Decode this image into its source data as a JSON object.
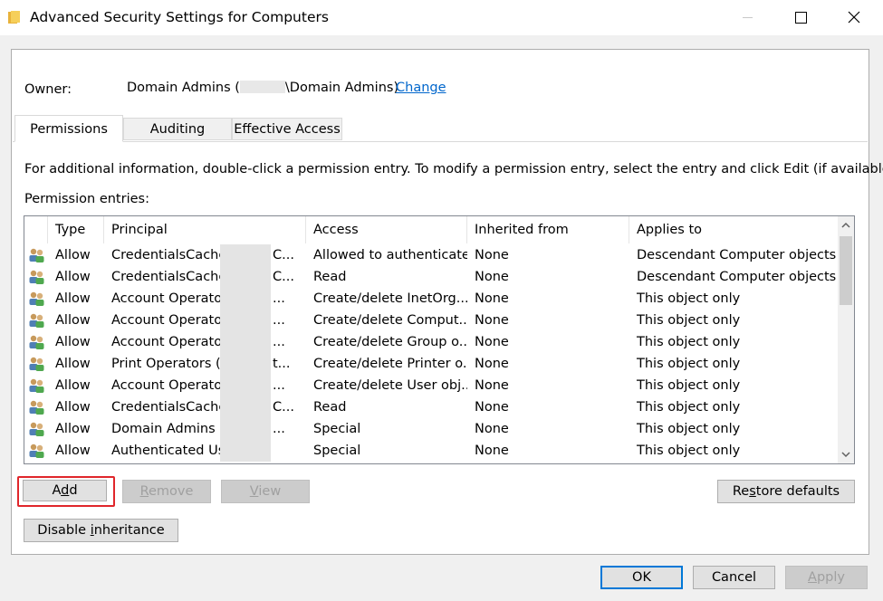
{
  "window": {
    "title": "Advanced Security Settings for Computers"
  },
  "owner": {
    "label": "Owner:",
    "name_prefix": "Domain Admins (",
    "name_suffix": "\\Domain Admins)",
    "change_link": "Change"
  },
  "tabs": [
    {
      "label": "Permissions",
      "active": true
    },
    {
      "label": "Auditing",
      "active": false
    },
    {
      "label": "Effective Access",
      "active": false
    }
  ],
  "permissions": {
    "info_text": "For additional information, double-click a permission entry. To modify a permission entry, select the entry and click Edit (if available).",
    "entries_label": "Permission entries:",
    "columns": [
      "Type",
      "Principal",
      "Access",
      "Inherited from",
      "Applies to"
    ],
    "rows": [
      {
        "type": "Allow",
        "principal": "CredentialsCache",
        "principal_tail": "C...",
        "access": "Allowed to authenticate",
        "inherited_from": "None",
        "applies_to": "Descendant Computer objects"
      },
      {
        "type": "Allow",
        "principal": "CredentialsCache",
        "principal_tail": "C...",
        "access": "Read",
        "inherited_from": "None",
        "applies_to": "Descendant Computer objects"
      },
      {
        "type": "Allow",
        "principal": "Account Operato",
        "principal_tail": "...",
        "access": "Create/delete InetOrg...",
        "inherited_from": "None",
        "applies_to": "This object only"
      },
      {
        "type": "Allow",
        "principal": "Account Operato",
        "principal_tail": "...",
        "access": "Create/delete Comput...",
        "inherited_from": "None",
        "applies_to": "This object only"
      },
      {
        "type": "Allow",
        "principal": "Account Operato",
        "principal_tail": "...",
        "access": "Create/delete Group o...",
        "inherited_from": "None",
        "applies_to": "This object only"
      },
      {
        "type": "Allow",
        "principal": "Print Operators (D",
        "principal_tail": "t...",
        "access": "Create/delete Printer o...",
        "inherited_from": "None",
        "applies_to": "This object only"
      },
      {
        "type": "Allow",
        "principal": "Account Operato",
        "principal_tail": "...",
        "access": "Create/delete User obj...",
        "inherited_from": "None",
        "applies_to": "This object only"
      },
      {
        "type": "Allow",
        "principal": "CredentialsCache",
        "principal_tail": "C...",
        "access": "Read",
        "inherited_from": "None",
        "applies_to": "This object only"
      },
      {
        "type": "Allow",
        "principal": "Domain Admins (",
        "principal_tail": "...",
        "access": "Special",
        "inherited_from": "None",
        "applies_to": "This object only"
      },
      {
        "type": "Allow",
        "principal": "Authenticated Users",
        "principal_tail": "",
        "access": "Special",
        "inherited_from": "None",
        "applies_to": "This object only"
      }
    ]
  },
  "buttons": {
    "add": {
      "pre": "A",
      "key": "d",
      "post": "d"
    },
    "remove": {
      "pre": "",
      "key": "R",
      "post": "emove"
    },
    "view": {
      "pre": "",
      "key": "V",
      "post": "iew"
    },
    "restore": {
      "pre": "Re",
      "key": "s",
      "post": "tore defaults"
    },
    "disable": {
      "pre": "Disable ",
      "key": "i",
      "post": "nheritance"
    },
    "ok": "OK",
    "cancel": "Cancel",
    "apply": {
      "pre": "",
      "key": "A",
      "post": "pply"
    }
  },
  "icons": {
    "folder": "folder-icon",
    "minimize": "minimize-icon",
    "maximize": "maximize-icon",
    "close": "close-icon",
    "principal": "user-group-icon",
    "scroll_up": "chevron-up-icon",
    "scroll_down": "chevron-down-icon"
  },
  "colors": {
    "link": "#0066cc",
    "highlight": "#e0262b",
    "default_button_border": "#0078d7"
  }
}
